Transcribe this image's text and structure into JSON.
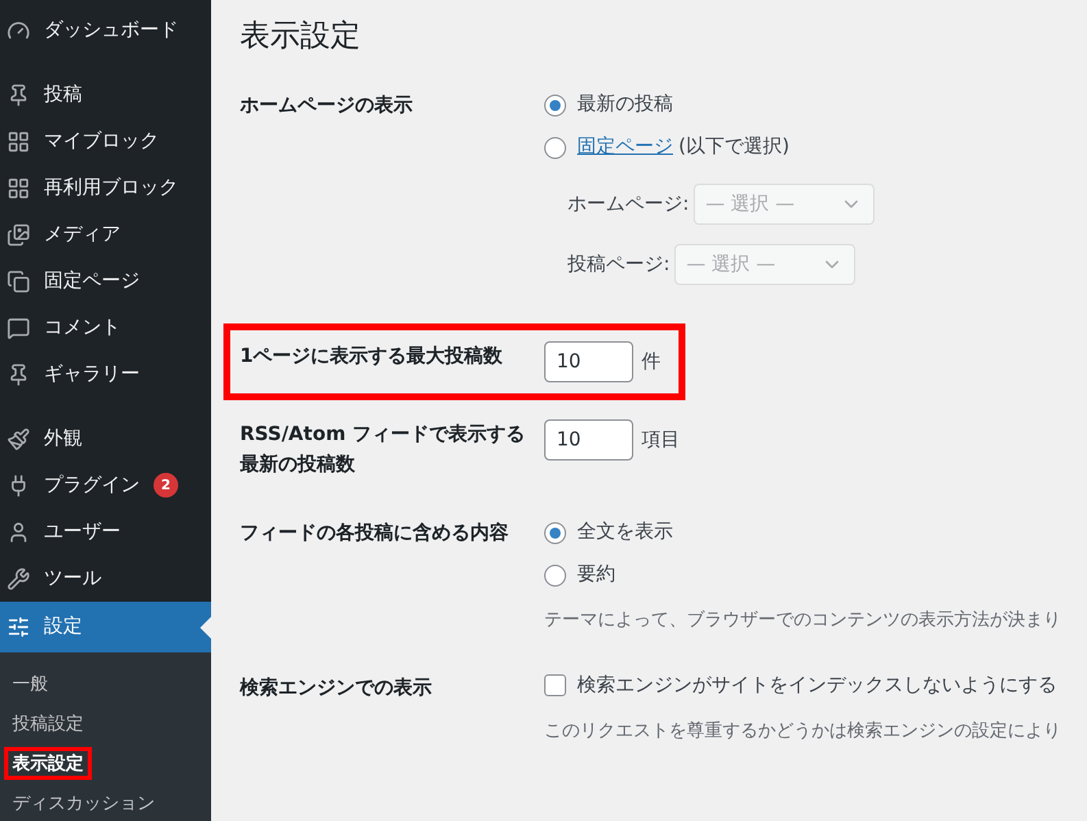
{
  "sidebar": {
    "groups": [
      [
        {
          "label": "ダッシュボード",
          "selected": false
        }
      ],
      [
        {
          "label": "投稿",
          "selected": false
        },
        {
          "label": "マイブロック",
          "selected": false
        },
        {
          "label": "再利用ブロック",
          "selected": false
        },
        {
          "label": "メディア",
          "selected": false
        },
        {
          "label": "固定ページ",
          "selected": false
        },
        {
          "label": "コメント",
          "selected": false
        },
        {
          "label": "ギャラリー",
          "selected": false
        }
      ],
      [
        {
          "label": "外観",
          "selected": false
        },
        {
          "label": "プラグイン",
          "badge": "2",
          "selected": false
        },
        {
          "label": "ユーザー",
          "selected": false
        },
        {
          "label": "ツール",
          "selected": false
        },
        {
          "label": "設定",
          "selected": true,
          "submenu": [
            {
              "label": "一般",
              "selected": false,
              "highlighted": false
            },
            {
              "label": "投稿設定",
              "selected": false,
              "highlighted": false
            },
            {
              "label": "表示設定",
              "selected": true,
              "highlighted": true
            },
            {
              "label": "ディスカッション",
              "selected": false,
              "highlighted": false
            }
          ]
        }
      ]
    ]
  },
  "page_title": "表示設定",
  "settings": [
    {
      "kind": "radio",
      "label": "ホームページの表示",
      "highlighted": false,
      "options": [
        {
          "label": "最新の投稿",
          "selected": true
        },
        {
          "link": "固定ページ",
          "label": "(以下で選択)",
          "selected": false
        }
      ],
      "selects": [
        {
          "label": "ホームページ:",
          "value": "— 選択 —",
          "disabled": true
        },
        {
          "label": "投稿ページ:",
          "value": "— 選択 —",
          "disabled": true
        }
      ]
    },
    {
      "kind": "number",
      "label": "1ページに表示する最大投稿数",
      "highlighted": true,
      "value": "10",
      "unit": "件"
    },
    {
      "kind": "number",
      "label": "RSS/Atom フィードで表示する最新の投稿数",
      "highlighted": false,
      "value": "10",
      "unit": "項目"
    },
    {
      "kind": "radio",
      "label": "フィードの各投稿に含める内容",
      "highlighted": false,
      "options": [
        {
          "label": "全文を表示",
          "selected": true
        },
        {
          "label": "要約",
          "selected": false
        }
      ],
      "description": "テーマによって、ブラウザーでのコンテンツの表示方法が決まり"
    },
    {
      "kind": "checkbox",
      "label": "検索エンジンでの表示",
      "highlighted": false,
      "checkbox": {
        "label": "検索エンジンがサイトをインデックスしないようにする",
        "checked": false
      },
      "description": "このリクエストを尊重するかどうかは検索エンジンの設定により"
    }
  ]
}
